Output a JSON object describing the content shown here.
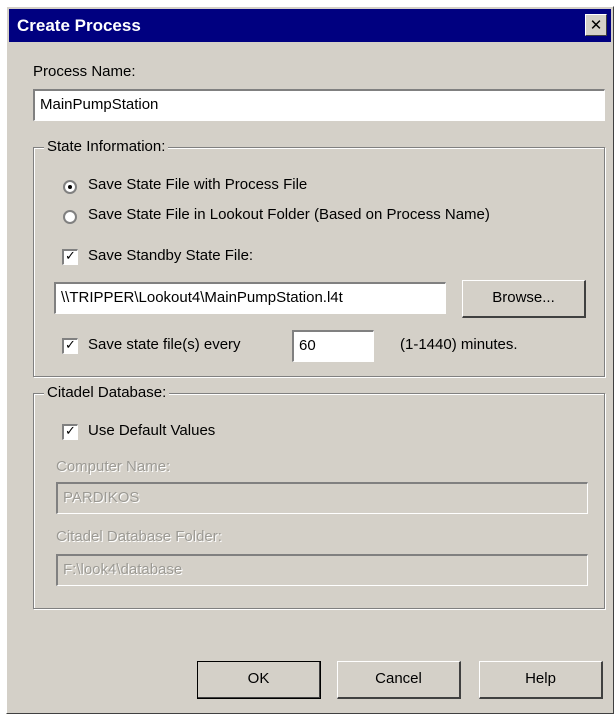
{
  "window": {
    "title": "Create Process",
    "close_glyph": "✕"
  },
  "process_name": {
    "label": "Process Name:",
    "value": "MainPumpStation"
  },
  "state_information": {
    "legend": "State Information:",
    "radio_process_file": {
      "label": "Save State File with Process File",
      "selected": true
    },
    "radio_lookout_folder": {
      "label": "Save State File in Lookout Folder (Based on Process Name)",
      "selected": false
    },
    "standby": {
      "label": "Save Standby State File:",
      "checked": true,
      "path": "\\\\TRIPPER\\Lookout4\\MainPumpStation.l4t"
    },
    "browse_label": "Browse...",
    "save_every": {
      "label": "Save state file(s) every",
      "checked": true,
      "value": "60",
      "range_text": "(1-1440) minutes."
    }
  },
  "citadel": {
    "legend": "Citadel Database:",
    "use_default": {
      "label": "Use Default Values",
      "checked": true
    },
    "computer_name": {
      "label": "Computer Name:",
      "value": "PARDIKOS"
    },
    "database_folder": {
      "label": "Citadel Database Folder:",
      "value": "F:\\look4\\database"
    }
  },
  "buttons": {
    "ok": "OK",
    "cancel": "Cancel",
    "help": "Help"
  },
  "colors": {
    "titlebar": "#000080",
    "face": "#d4d0c8"
  }
}
